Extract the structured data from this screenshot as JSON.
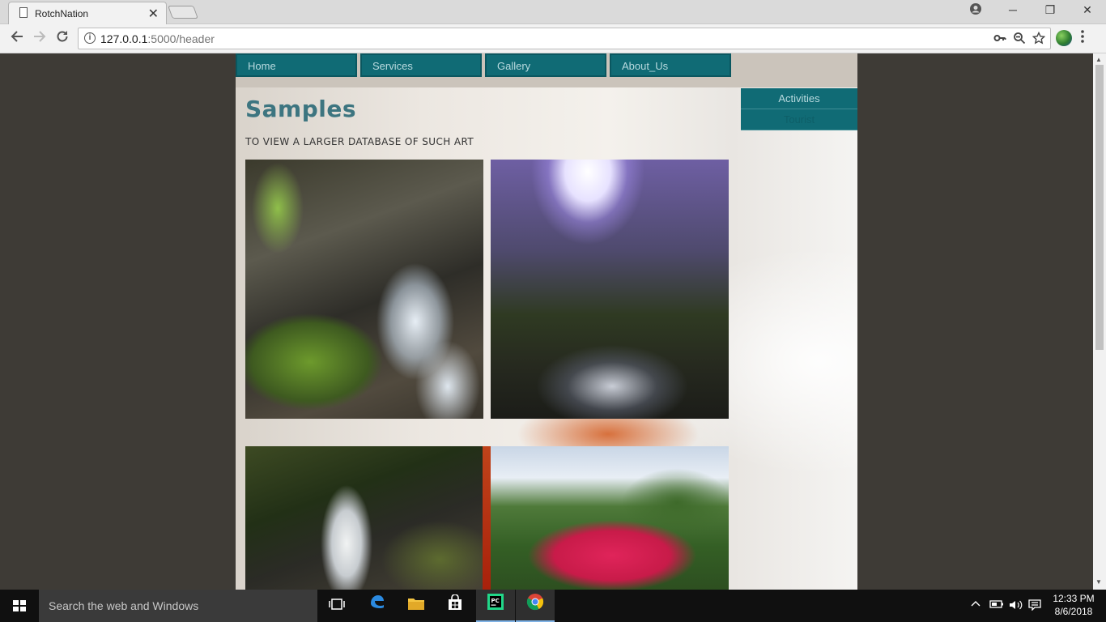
{
  "browser": {
    "tab_title": "RotchNation",
    "url_host": "127.0.0.1",
    "url_path": ":5000/header",
    "close_tab_glyph": "✕",
    "minimize_glyph": "─",
    "restore_glyph": "❐",
    "close_glyph": "✕"
  },
  "site": {
    "nav": [
      "Home",
      "Services",
      "Gallery",
      "About_Us"
    ],
    "side_menu": [
      "Activities",
      "Tourist"
    ],
    "title": "Samples",
    "subtitle": "TO VIEW A LARGER DATABASE OF SUCH ART"
  },
  "taskbar": {
    "search_placeholder": "Search the web and Windows",
    "time": "12:33 PM",
    "date": "8/6/2018"
  },
  "icons": {
    "back": "back-arrow-icon",
    "forward": "forward-arrow-icon",
    "reload": "reload-icon",
    "key": "key-icon",
    "zoom": "zoom-icon",
    "star": "star-icon",
    "menu": "kebab-menu-icon"
  }
}
